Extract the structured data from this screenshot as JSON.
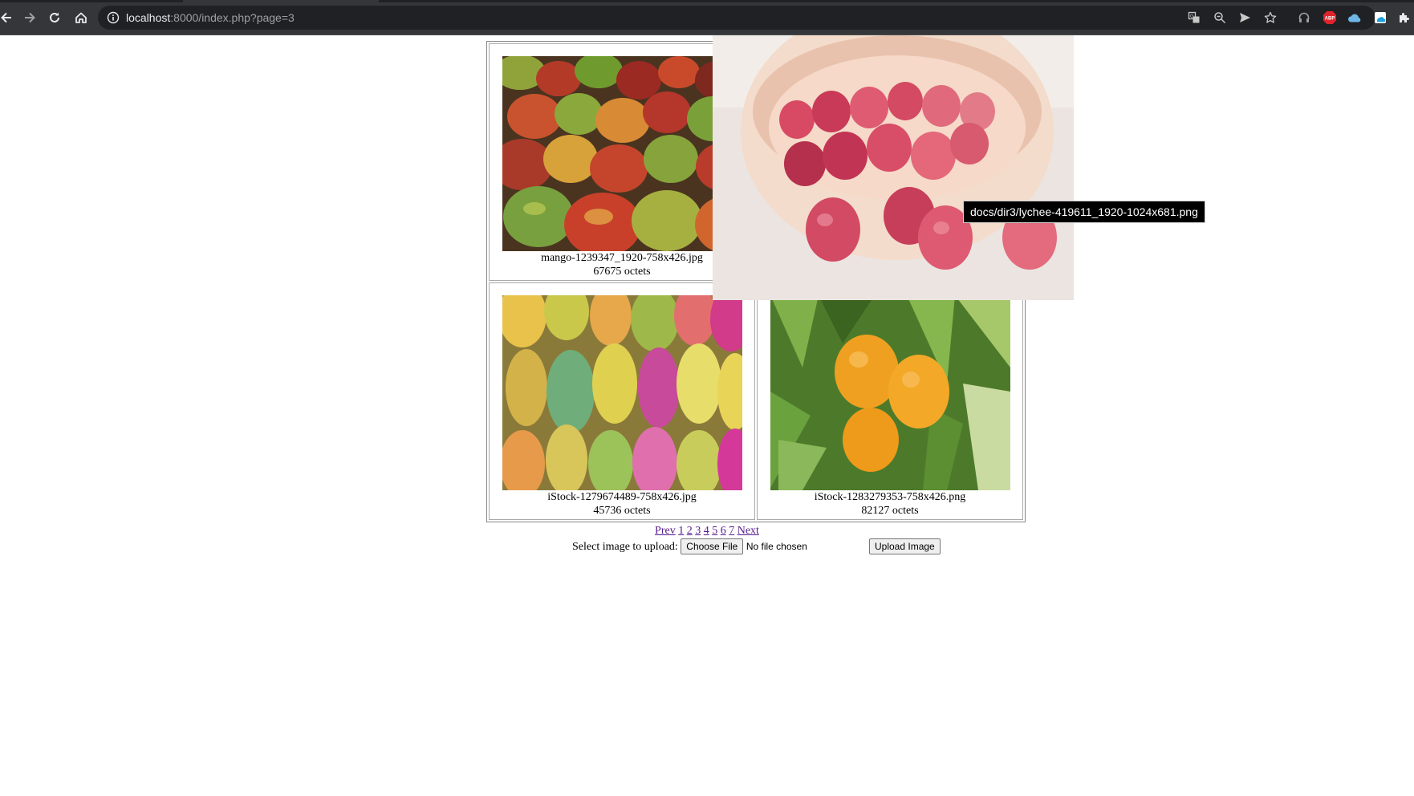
{
  "browser": {
    "url_host": "localhost",
    "url_rest": ":8000/index.php?page=3",
    "extensions": [
      "translate-icon",
      "zoom-icon",
      "send-icon",
      "bookmark-star-icon",
      "headset-icon",
      "adblock-icon",
      "cloud-icon",
      "screenshot-icon",
      "puzzle-icon"
    ]
  },
  "gallery": {
    "items": [
      {
        "filename": "mango-1239347_1920-758x426.jpg",
        "size": "67675 octets"
      },
      {
        "filename": "",
        "size": ""
      },
      {
        "filename": "iStock-1279674489-758x426.jpg",
        "size": "45736 octets"
      },
      {
        "filename": "iStock-1283279353-758x426.png",
        "size": "82127 octets"
      }
    ]
  },
  "pagination": {
    "prev": "Prev",
    "pages": [
      "1",
      "2",
      "3",
      "4",
      "5",
      "6",
      "7"
    ],
    "next": "Next"
  },
  "upload": {
    "label": "Select image to upload:",
    "choose_file": "Choose File",
    "no_file": "No file chosen",
    "submit": "Upload Image"
  },
  "hover": {
    "tooltip": "docs/dir3/lychee-419611_1920-1024x681.png"
  }
}
